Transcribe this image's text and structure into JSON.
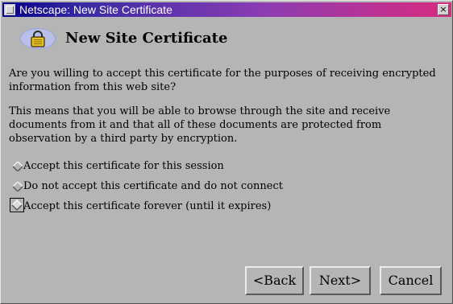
{
  "window": {
    "title": "Netscape: New Site Certificate",
    "close_glyph": "×"
  },
  "header": {
    "title": "New Site Certificate",
    "icon": "padlock-icon"
  },
  "body": {
    "question": "Are you willing to accept this certificate for the purposes of receiving encrypted information from this web site?",
    "explanation": "This means that you will be able to browse through the site and receive documents from it and that all of these documents are protected from observation by a third party by encryption."
  },
  "options": [
    {
      "label": "Accept this certificate for this session",
      "selected": false
    },
    {
      "label": "Do not accept this certificate and do not connect",
      "selected": false
    },
    {
      "label": "Accept this certificate forever (until it expires)",
      "selected": true
    }
  ],
  "buttons": {
    "back": "<Back",
    "next": "Next>",
    "cancel": "Cancel"
  },
  "colors": {
    "background": "#b5b5b5",
    "titlebar_start": "#030088",
    "titlebar_end": "#d92b7f",
    "lock_badge": "#b8bfe8",
    "lock_gold": "#e8c21a"
  }
}
